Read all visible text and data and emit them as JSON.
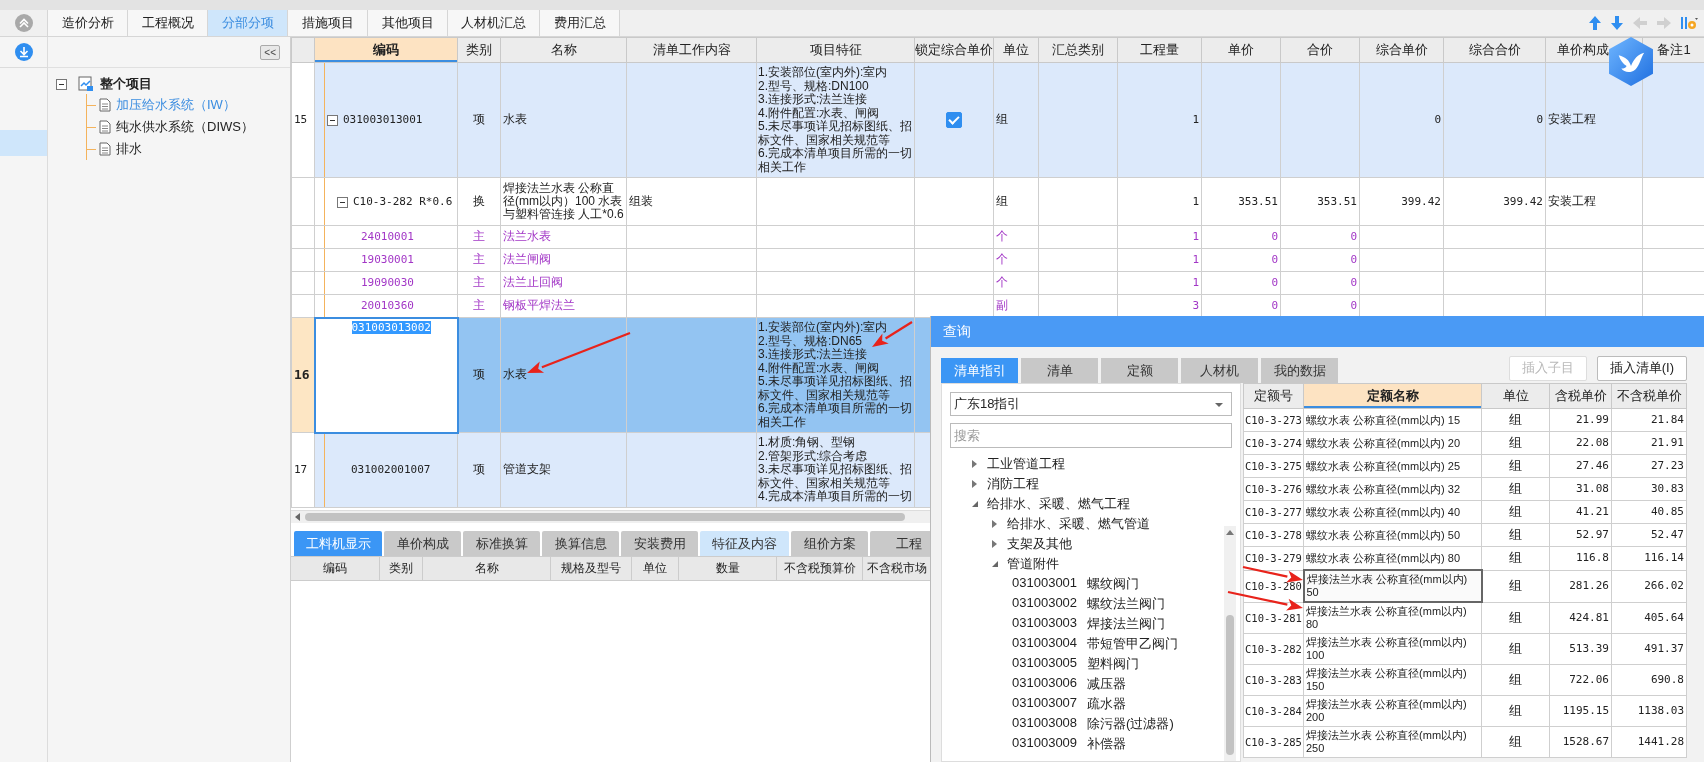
{
  "top_tabs": [
    {
      "label": "造价分析",
      "selected": false
    },
    {
      "label": "工程概况",
      "selected": false
    },
    {
      "label": "分部分项",
      "selected": true
    },
    {
      "label": "措施项目",
      "selected": false
    },
    {
      "label": "其他项目",
      "selected": false
    },
    {
      "label": "人材机汇总",
      "selected": false
    },
    {
      "label": "费用汇总",
      "selected": false
    }
  ],
  "sidebar": {
    "rows": [
      {
        "selected": true
      }
    ]
  },
  "project_tree": {
    "collapse_label": "<<",
    "root": {
      "label": "整个项目",
      "expanded": true,
      "children": [
        {
          "label": "加压给水系统（IW）",
          "selected": true
        },
        {
          "label": "纯水供水系统（DIWS）",
          "selected": false
        },
        {
          "label": "排水",
          "selected": false
        }
      ]
    }
  },
  "grid": {
    "columns": [
      {
        "label": "编码",
        "selected": true
      },
      {
        "label": "类别",
        "selected": false
      },
      {
        "label": "名称",
        "selected": false
      },
      {
        "label": "清单工作内容",
        "selected": false
      },
      {
        "label": "项目特征",
        "selected": false
      },
      {
        "label": "锁定综合单价",
        "selected": false
      },
      {
        "label": "单位",
        "selected": false
      },
      {
        "label": "汇总类别",
        "selected": false
      },
      {
        "label": "工程量",
        "selected": false
      },
      {
        "label": "单价",
        "selected": false
      },
      {
        "label": "合价",
        "selected": false
      },
      {
        "label": "综合单价",
        "selected": false
      },
      {
        "label": "综合合价",
        "selected": false
      },
      {
        "label": "单价构成",
        "selected": false
      },
      {
        "label": "备注1",
        "selected": false
      }
    ],
    "rows": [
      {
        "kind": "list",
        "num": "15",
        "code": "031003013001",
        "type": "项",
        "name": "水表",
        "features": [
          "1.安装部位(室内外):室内",
          "2.型号、规格:DN100",
          "3.连接形式:法兰连接",
          "4.附件配置:水表、闸阀",
          "5.未尽事项详见招标图纸、招标文件、国家相关规范等",
          "6.完成本清单项目所需的一切相关工作"
        ],
        "locked": true,
        "unit": "组",
        "qty": "1",
        "total_unit_price": "0",
        "total_price": "0",
        "composition": "安装工程",
        "expanded": true,
        "selected": false,
        "children": [
          {
            "kind": "quota",
            "code": "C10-3-282 R*0.6",
            "type": "换",
            "name": "焊接法兰水表 公称直径(mm以内）100  水表与塑料管连接 人工*0.6",
            "work": "组装",
            "unit": "组",
            "qty": "1",
            "price": "353.51",
            "amount": "353.51",
            "total_unit_price": "399.42",
            "total_price": "399.42",
            "composition": "安装工程",
            "expanded": true,
            "selected": false,
            "children": [
              {
                "kind": "material",
                "code": "24010001",
                "type": "主",
                "name": "法兰水表",
                "unit": "个",
                "qty": "1",
                "price": "0",
                "amount": "0",
                "selected": false
              },
              {
                "kind": "material",
                "code": "19030001",
                "type": "主",
                "name": "法兰闸阀",
                "unit": "个",
                "qty": "1",
                "price": "0",
                "amount": "0",
                "selected": false
              },
              {
                "kind": "material",
                "code": "19090030",
                "type": "主",
                "name": "法兰止回阀",
                "unit": "个",
                "qty": "1",
                "price": "0",
                "amount": "0",
                "selected": false
              },
              {
                "kind": "material",
                "code": "20010360",
                "type": "主",
                "name": "钢板平焊法兰",
                "unit": "副",
                "qty": "3",
                "price": "0",
                "amount": "0",
                "selected": false
              }
            ]
          }
        ]
      },
      {
        "kind": "list",
        "num": "16",
        "code": "031003013002",
        "type": "项",
        "name": "水表",
        "features": [
          "1.安装部位(室内外):室内",
          "2.型号、规格:DN65",
          "3.连接形式:法兰连接",
          "4.附件配置:水表、闸阀",
          "5.未尽事项详见招标图纸、招标文件、国家相关规范等",
          "6.完成本清单项目所需的一切相关工作"
        ],
        "selected": true
      },
      {
        "kind": "list",
        "num": "17",
        "code": "031002001007",
        "type": "项",
        "name": "管道支架",
        "features": [
          "1.材质:角钢、型钢",
          "2.管架形式:综合考虑",
          "3.未尽事项详见招标图纸、招标文件、国家相关规范等",
          "4.完成本清单项目所需的一切"
        ],
        "selected": false
      }
    ]
  },
  "bottom": {
    "tabs": [
      {
        "label": "工料机显示",
        "selected": true,
        "hovered": false
      },
      {
        "label": "单价构成",
        "selected": false,
        "hovered": false
      },
      {
        "label": "标准换算",
        "selected": false,
        "hovered": false
      },
      {
        "label": "换算信息",
        "selected": false,
        "hovered": false
      },
      {
        "label": "安装费用",
        "selected": false,
        "hovered": false
      },
      {
        "label": "特征及内容",
        "selected": false,
        "hovered": true
      },
      {
        "label": "组价方案",
        "selected": false,
        "hovered": false
      },
      {
        "label": "工程",
        "selected": false,
        "hovered": false
      }
    ],
    "columns": [
      "编码",
      "类别",
      "名称",
      "规格及型号",
      "单位",
      "数量",
      "不含税预算价",
      "不含税市场"
    ]
  },
  "dialog": {
    "title": "查询",
    "tabs": [
      {
        "label": "清单指引",
        "selected": true
      },
      {
        "label": "清单",
        "selected": false
      },
      {
        "label": "定额",
        "selected": false
      },
      {
        "label": "人材机",
        "selected": false
      },
      {
        "label": "我的数据",
        "selected": false
      }
    ],
    "buttons": [
      {
        "label": "插入子目",
        "disabled": true
      },
      {
        "label": "插入清单(I)",
        "disabled": false
      }
    ],
    "dropdown": "广东18指引",
    "search": {
      "placeholder": "搜索"
    },
    "tree": [
      {
        "label": "工业管道工程",
        "expanded": false
      },
      {
        "label": "消防工程",
        "expanded": false
      },
      {
        "label": "给排水、采暖、燃气工程",
        "expanded": true,
        "children": [
          {
            "label": "给排水、采暖、燃气管道",
            "expanded": false
          },
          {
            "label": "支架及其他",
            "expanded": false
          },
          {
            "label": "管道附件",
            "expanded": true,
            "children": [
              {
                "code": "031003001",
                "label": "螺纹阀门"
              },
              {
                "code": "031003002",
                "label": "螺纹法兰阀门"
              },
              {
                "code": "031003003",
                "label": "焊接法兰阀门"
              },
              {
                "code": "031003004",
                "label": "带短管甲乙阀门"
              },
              {
                "code": "031003005",
                "label": "塑料阀门"
              },
              {
                "code": "031003006",
                "label": "减压器"
              },
              {
                "code": "031003007",
                "label": "疏水器"
              },
              {
                "code": "031003008",
                "label": "除污器(过滤器)"
              },
              {
                "code": "031003009",
                "label": "补偿器"
              }
            ]
          }
        ]
      }
    ],
    "table": {
      "columns": [
        {
          "label": "定额号",
          "selected": false
        },
        {
          "label": "定额名称",
          "selected": true
        },
        {
          "label": "单位",
          "selected": false
        },
        {
          "label": "含税单价",
          "selected": false
        },
        {
          "label": "不含税单价",
          "selected": false
        }
      ],
      "rows": [
        {
          "code": "C10-3-273",
          "name": "螺纹水表 公称直径(mm以内) 15",
          "unit": "组",
          "price_tax": "21.99",
          "price_notax": "21.84",
          "selected": false
        },
        {
          "code": "C10-3-274",
          "name": "螺纹水表 公称直径(mm以内) 20",
          "unit": "组",
          "price_tax": "22.08",
          "price_notax": "21.91",
          "selected": false
        },
        {
          "code": "C10-3-275",
          "name": "螺纹水表 公称直径(mm以内) 25",
          "unit": "组",
          "price_tax": "27.46",
          "price_notax": "27.23",
          "selected": false
        },
        {
          "code": "C10-3-276",
          "name": "螺纹水表 公称直径(mm以内) 32",
          "unit": "组",
          "price_tax": "31.08",
          "price_notax": "30.83",
          "selected": false
        },
        {
          "code": "C10-3-277",
          "name": "螺纹水表 公称直径(mm以内) 40",
          "unit": "组",
          "price_tax": "41.21",
          "price_notax": "40.85",
          "selected": false
        },
        {
          "code": "C10-3-278",
          "name": "螺纹水表 公称直径(mm以内) 50",
          "unit": "组",
          "price_tax": "52.97",
          "price_notax": "52.47",
          "selected": false
        },
        {
          "code": "C10-3-279",
          "name": "螺纹水表 公称直径(mm以内) 80",
          "unit": "组",
          "price_tax": "116.8",
          "price_notax": "116.14",
          "selected": false
        },
        {
          "code": "C10-3-280",
          "name": "焊接法兰水表 公称直径(mm以内) 50",
          "unit": "组",
          "price_tax": "281.26",
          "price_notax": "266.02",
          "selected": true
        },
        {
          "code": "C10-3-281",
          "name": "焊接法兰水表 公称直径(mm以内) 80",
          "unit": "组",
          "price_tax": "424.81",
          "price_notax": "405.64",
          "selected": false
        },
        {
          "code": "C10-3-282",
          "name": "焊接法兰水表 公称直径(mm以内) 100",
          "unit": "组",
          "price_tax": "513.39",
          "price_notax": "491.37",
          "selected": false
        },
        {
          "code": "C10-3-283",
          "name": "焊接法兰水表 公称直径(mm以内) 150",
          "unit": "组",
          "price_tax": "722.06",
          "price_notax": "690.8",
          "selected": false
        },
        {
          "code": "C10-3-284",
          "name": "焊接法兰水表 公称直径(mm以内) 200",
          "unit": "组",
          "price_tax": "1195.15",
          "price_notax": "1138.03",
          "selected": false
        },
        {
          "code": "C10-3-285",
          "name": "焊接法兰水表 公称直径(mm以内) 250",
          "unit": "组",
          "price_tax": "1528.67",
          "price_notax": "1441.28",
          "selected": false
        }
      ]
    }
  },
  "annotations": [
    {
      "kind": "arrow"
    },
    {
      "kind": "arrow"
    },
    {
      "kind": "arrow"
    },
    {
      "kind": "arrow"
    }
  ]
}
